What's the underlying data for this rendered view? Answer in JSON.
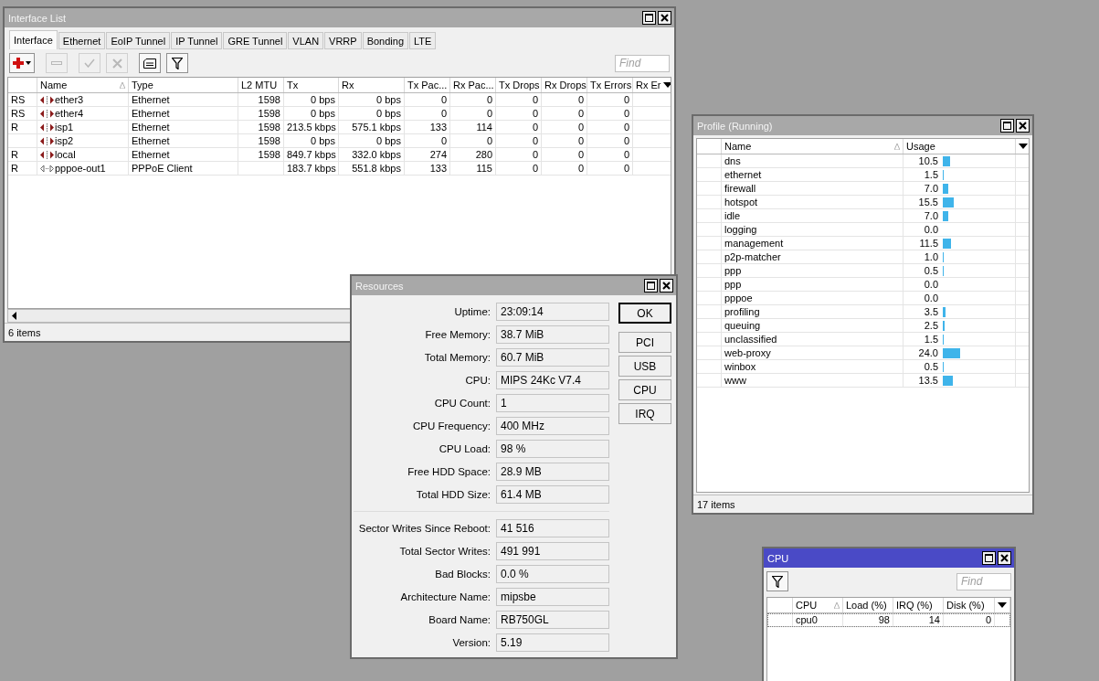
{
  "interface_list": {
    "title": "Interface List",
    "active": false,
    "tabs": [
      {
        "label": "Interface",
        "selected": true
      },
      {
        "label": "Ethernet",
        "selected": false
      },
      {
        "label": "EoIP Tunnel",
        "selected": false
      },
      {
        "label": "IP Tunnel",
        "selected": false
      },
      {
        "label": "GRE Tunnel",
        "selected": false
      },
      {
        "label": "VLAN",
        "selected": false
      },
      {
        "label": "VRRP",
        "selected": false
      },
      {
        "label": "Bonding",
        "selected": false
      },
      {
        "label": "LTE",
        "selected": false
      }
    ],
    "toolbar": [
      {
        "kind": "add",
        "disabled": false
      },
      {
        "kind": "remove",
        "disabled": true
      },
      {
        "kind": "enable",
        "disabled": true
      },
      {
        "kind": "disable",
        "disabled": true
      },
      {
        "kind": "comment",
        "disabled": false
      },
      {
        "kind": "filter",
        "disabled": false
      }
    ],
    "find_placeholder": "Find",
    "columns": [
      "Name",
      "Type",
      "L2 MTU",
      "Tx",
      "Rx",
      "Tx Pac...",
      "Rx Pac...",
      "Tx Drops",
      "Rx Drops",
      "Tx Errors",
      "Rx Er"
    ],
    "rows": [
      {
        "flags": "RS",
        "kind": "ethernet",
        "name": "ether3",
        "type": "Ethernet",
        "l2mtu": "1598",
        "tx": "0 bps",
        "rx": "0 bps",
        "tx_packets": "0",
        "rx_packets": "0",
        "tx_drops": "0",
        "rx_drops": "0",
        "tx_errors": "0"
      },
      {
        "flags": "RS",
        "kind": "ethernet",
        "name": "ether4",
        "type": "Ethernet",
        "l2mtu": "1598",
        "tx": "0 bps",
        "rx": "0 bps",
        "tx_packets": "0",
        "rx_packets": "0",
        "tx_drops": "0",
        "rx_drops": "0",
        "tx_errors": "0"
      },
      {
        "flags": "R",
        "kind": "ethernet",
        "name": "isp1",
        "type": "Ethernet",
        "l2mtu": "1598",
        "tx": "213.5 kbps",
        "rx": "575.1 kbps",
        "tx_packets": "133",
        "rx_packets": "114",
        "tx_drops": "0",
        "rx_drops": "0",
        "tx_errors": "0"
      },
      {
        "flags": "",
        "kind": "ethernet",
        "name": "isp2",
        "type": "Ethernet",
        "l2mtu": "1598",
        "tx": "0 bps",
        "rx": "0 bps",
        "tx_packets": "0",
        "rx_packets": "0",
        "tx_drops": "0",
        "rx_drops": "0",
        "tx_errors": "0"
      },
      {
        "flags": "R",
        "kind": "ethernet",
        "name": "local",
        "type": "Ethernet",
        "l2mtu": "1598",
        "tx": "849.7 kbps",
        "rx": "332.0 kbps",
        "tx_packets": "274",
        "rx_packets": "280",
        "tx_drops": "0",
        "rx_drops": "0",
        "tx_errors": "0"
      },
      {
        "flags": "R",
        "kind": "pppoe",
        "name": "pppoe-out1",
        "type": "PPPoE Client",
        "l2mtu": "",
        "tx": "183.7 kbps",
        "rx": "551.8 kbps",
        "tx_packets": "133",
        "rx_packets": "115",
        "tx_drops": "0",
        "rx_drops": "0",
        "tx_errors": "0"
      }
    ],
    "status": "6 items"
  },
  "profile": {
    "title": "Profile (Running)",
    "active": false,
    "columns": [
      "Name",
      "Usage"
    ],
    "rows": [
      {
        "name": "dns",
        "usage": "10.5",
        "level": 0.105
      },
      {
        "name": "ethernet",
        "usage": "1.5",
        "level": 0.015
      },
      {
        "name": "firewall",
        "usage": "7.0",
        "level": 0.07
      },
      {
        "name": "hotspot",
        "usage": "15.5",
        "level": 0.155
      },
      {
        "name": "idle",
        "usage": "7.0",
        "level": 0.07
      },
      {
        "name": "logging",
        "usage": "0.0",
        "level": 0
      },
      {
        "name": "management",
        "usage": "11.5",
        "level": 0.115
      },
      {
        "name": "p2p-matcher",
        "usage": "1.0",
        "level": 0.01
      },
      {
        "name": "ppp",
        "usage": "0.5",
        "level": 0.005
      },
      {
        "name": "ppp",
        "usage": "0.0",
        "level": 0
      },
      {
        "name": "pppoe",
        "usage": "0.0",
        "level": 0
      },
      {
        "name": "profiling",
        "usage": "3.5",
        "level": 0.035
      },
      {
        "name": "queuing",
        "usage": "2.5",
        "level": 0.025
      },
      {
        "name": "unclassified",
        "usage": "1.5",
        "level": 0.015
      },
      {
        "name": "web-proxy",
        "usage": "24.0",
        "level": 0.24
      },
      {
        "name": "winbox",
        "usage": "0.5",
        "level": 0.005
      },
      {
        "name": "www",
        "usage": "13.5",
        "level": 0.135
      }
    ],
    "status": "17 items"
  },
  "resources": {
    "title": "Resources",
    "active": false,
    "fields": [
      {
        "label": "Uptime:",
        "value": "23:09:14"
      },
      {
        "label": "Free Memory:",
        "value": "38.7 MiB"
      },
      {
        "label": "Total Memory:",
        "value": "60.7 MiB"
      },
      {
        "label": "CPU:",
        "value": "MIPS 24Kc V7.4"
      },
      {
        "label": "CPU Count:",
        "value": "1"
      },
      {
        "label": "CPU Frequency:",
        "value": "400 MHz"
      },
      {
        "label": "CPU Load:",
        "value": "98 %"
      },
      {
        "label": "Free HDD Space:",
        "value": "28.9 MB"
      },
      {
        "label": "Total HDD Size:",
        "value": "61.4 MB"
      }
    ],
    "disk_fields": [
      {
        "label": "Sector Writes Since Reboot:",
        "value": "41 516"
      },
      {
        "label": "Total Sector Writes:",
        "value": "491 991"
      },
      {
        "label": "Bad Blocks:",
        "value": "0.0 %"
      },
      {
        "label": "Architecture Name:",
        "value": "mipsbe"
      },
      {
        "label": "Board Name:",
        "value": "RB750GL"
      },
      {
        "label": "Version:",
        "value": "5.19"
      }
    ],
    "buttons": [
      {
        "label": "OK",
        "default": true
      },
      {
        "label": "PCI",
        "default": false
      },
      {
        "label": "USB",
        "default": false
      },
      {
        "label": "CPU",
        "default": false
      },
      {
        "label": "IRQ",
        "default": false
      }
    ]
  },
  "cpu": {
    "title": "CPU",
    "active": true,
    "find_placeholder": "Find",
    "columns": [
      "CPU",
      "Load (%)",
      "IRQ (%)",
      "Disk (%)"
    ],
    "rows": [
      {
        "cpu": "cpu0",
        "load": "98",
        "irq": "14",
        "disk": "0"
      }
    ]
  }
}
